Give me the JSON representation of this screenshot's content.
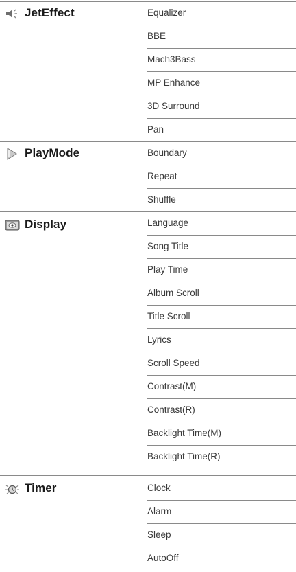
{
  "sections": [
    {
      "name": "JetEffect",
      "icon": "speaker-icon",
      "items": [
        "Equalizer",
        "BBE",
        "Mach3Bass",
        "MP Enhance",
        "3D Surround",
        "Pan"
      ]
    },
    {
      "name": "PlayMode",
      "icon": "play-mode-icon",
      "items": [
        "Boundary",
        "Repeat",
        "Shuffle"
      ]
    },
    {
      "name": "Display",
      "icon": "display-icon",
      "items": [
        "Language",
        "Song Title",
        "Play Time",
        "Album Scroll",
        "Title Scroll",
        "Lyrics",
        "Scroll Speed",
        "Contrast(M)",
        "Contrast(R)",
        "Backlight Time(M)",
        "Backlight Time(R)"
      ]
    },
    {
      "name": "Timer",
      "icon": "timer-icon",
      "items": [
        "Clock",
        "Alarm",
        "Sleep",
        "AutoOff"
      ]
    }
  ],
  "colors": {
    "rule": "#8a8a8a",
    "text": "#3a3a3a",
    "heading": "#1a1a1a"
  }
}
